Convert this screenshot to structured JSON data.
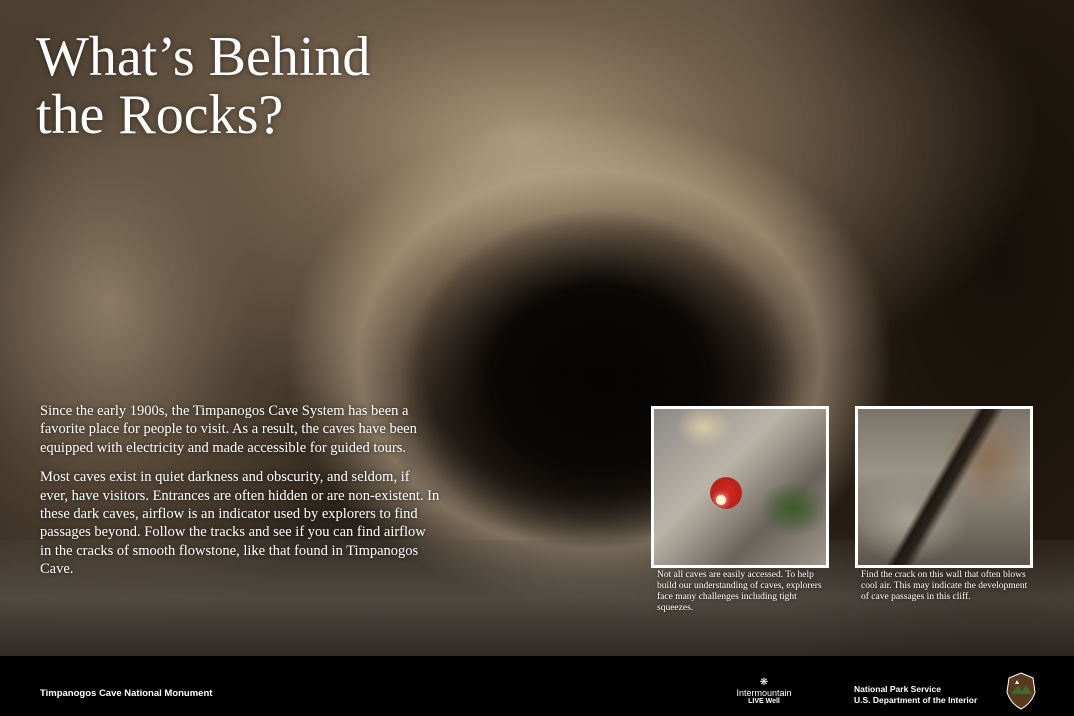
{
  "headline": {
    "line1": "What’s Behind",
    "line2": "the Rocks?"
  },
  "body": {
    "paragraphs": [
      "Since the early 1900s, the Timpanogos Cave System has been a favorite place for people to visit. As a result, the caves have been equipped with electricity and made accessible for guided tours.",
      "Most caves exist in quiet darkness and obscurity, and seldom, if ever, have visitors. Entrances are often hidden or are non-existent. In these dark caves, airflow is an indicator used by explorers to find passages beyond. Follow the tracks and see if you can find airflow in the cracks of smooth flowstone, like that found in Timpanogos Cave."
    ]
  },
  "insets": [
    {
      "caption": "Not all caves are easily accessed. To help build our understanding of caves, explorers face many challenges including tight squeezes."
    },
    {
      "caption": "Find the crack on this wall that often blows cool air. This may indicate the development of cave passages in this cliff."
    }
  ],
  "footer": {
    "site_name": "Timpanogos Cave National Monument",
    "sponsor_name": "Intermountain",
    "sponsor_tagline": "LIVE Well",
    "agency_line1": "National Park Service",
    "agency_line2": "U.S. Department of the Interior"
  },
  "icons": {
    "sponsor_logo": "sponsor-logo-icon",
    "nps_arrowhead": "nps-arrowhead-icon"
  },
  "colors": {
    "footer_bg": "#000000",
    "text": "#ffffff",
    "arrowhead_brown": "#5a3a1e",
    "arrowhead_green": "#3f6b2e"
  }
}
